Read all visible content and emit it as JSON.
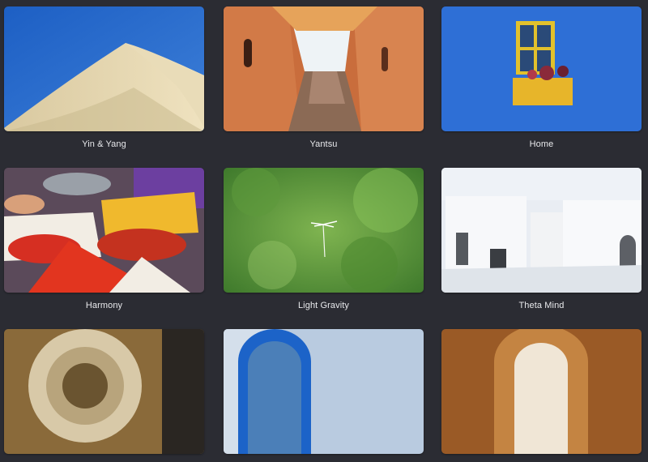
{
  "gallery": {
    "items": [
      {
        "title": "Yin & Yang"
      },
      {
        "title": "Yantsu"
      },
      {
        "title": "Home"
      },
      {
        "title": "Harmony"
      },
      {
        "title": "Light Gravity"
      },
      {
        "title": "Theta Mind"
      },
      {
        "title": ""
      },
      {
        "title": ""
      },
      {
        "title": ""
      }
    ]
  },
  "colors": {
    "background": "#2b2c33",
    "label": "#e8e9ec"
  }
}
